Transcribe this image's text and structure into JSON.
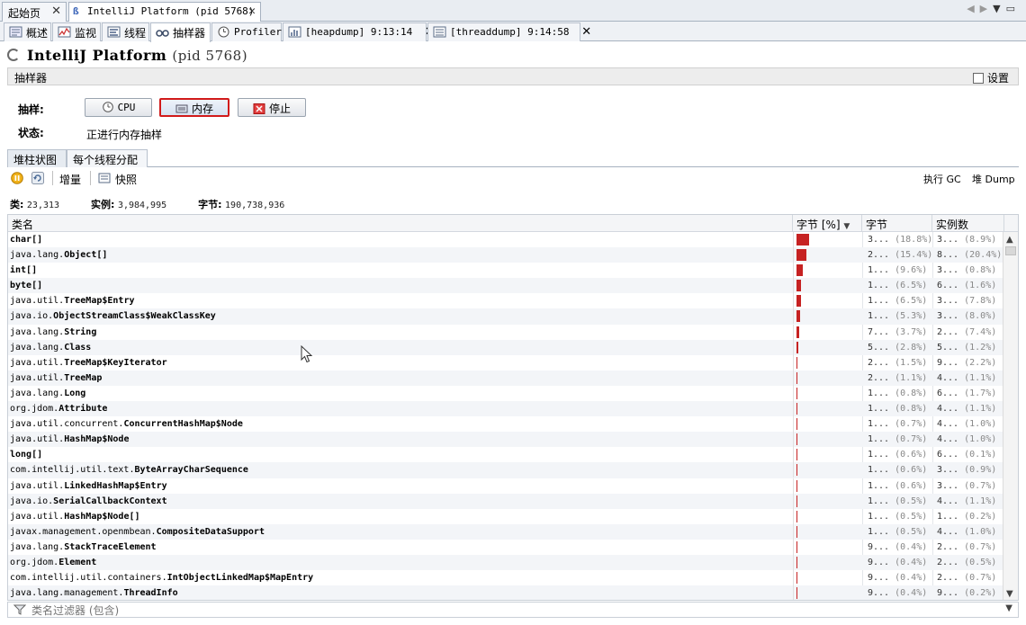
{
  "doc_tabs": [
    {
      "label": "起始页",
      "active": false
    },
    {
      "label": "IntelliJ Platform (pid 5768)",
      "active": true
    }
  ],
  "view_tabs": [
    {
      "label": "概述",
      "icon": "overview-icon"
    },
    {
      "label": "监视",
      "icon": "monitor-icon"
    },
    {
      "label": "线程",
      "icon": "threads-icon"
    },
    {
      "label": "抽样器",
      "icon": "sampler-icon"
    },
    {
      "label": "Profiler",
      "icon": "profiler-icon"
    },
    {
      "label": "[heapdump] 9:13:14",
      "icon": "heapdump-icon"
    },
    {
      "label": "[threaddump] 9:14:58",
      "icon": "threaddump-icon"
    }
  ],
  "header": {
    "app": "IntelliJ Platform",
    "pid": "(pid 5768)"
  },
  "sampler": {
    "section_title": "抽样器",
    "settings_label": "设置",
    "sample_label": "抽样:",
    "status_label": "状态:",
    "status_value": "正进行内存抽样",
    "buttons": {
      "cpu": "CPU",
      "memory": "内存",
      "stop": "停止"
    }
  },
  "sub_tabs": [
    "堆柱状图",
    "每个线程分配"
  ],
  "toolbar": {
    "delta": "增量",
    "snapshot": "快照",
    "gc": "执行 GC",
    "heap_dump": "堆 Dump"
  },
  "stats": {
    "classes_label": "类:",
    "classes": "23,313",
    "instances_label": "实例:",
    "instances": "3,984,995",
    "bytes_label": "字节:",
    "bytes": "190,738,936"
  },
  "table": {
    "columns": [
      "类名",
      "字节 [%]",
      "字节",
      "实例数"
    ],
    "rows": [
      {
        "pkg": "",
        "cls": "char[]",
        "pct": 18.8,
        "bytes": "3...",
        "bytes_pct": "(18.8%)",
        "inst": "3...",
        "inst_pct": "(8.9%)"
      },
      {
        "pkg": "java.lang.",
        "cls": "Object[]",
        "pct": 15.4,
        "bytes": "2...",
        "bytes_pct": "(15.4%)",
        "inst": "8...",
        "inst_pct": "(20.4%)"
      },
      {
        "pkg": "",
        "cls": "int[]",
        "pct": 9.6,
        "bytes": "1...",
        "bytes_pct": "(9.6%)",
        "inst": "3...",
        "inst_pct": "(0.8%)"
      },
      {
        "pkg": "",
        "cls": "byte[]",
        "pct": 6.5,
        "bytes": "1...",
        "bytes_pct": "(6.5%)",
        "inst": "6...",
        "inst_pct": "(1.6%)"
      },
      {
        "pkg": "java.util.",
        "cls": "TreeMap$Entry",
        "pct": 6.5,
        "bytes": "1...",
        "bytes_pct": "(6.5%)",
        "inst": "3...",
        "inst_pct": "(7.8%)"
      },
      {
        "pkg": "java.io.",
        "cls": "ObjectStreamClass$WeakClassKey",
        "pct": 5.3,
        "bytes": "1...",
        "bytes_pct": "(5.3%)",
        "inst": "3...",
        "inst_pct": "(8.0%)"
      },
      {
        "pkg": "java.lang.",
        "cls": "String",
        "pct": 3.7,
        "bytes": "7...",
        "bytes_pct": "(3.7%)",
        "inst": "2...",
        "inst_pct": "(7.4%)"
      },
      {
        "pkg": "java.lang.",
        "cls": "Class",
        "pct": 2.8,
        "bytes": "5...",
        "bytes_pct": "(2.8%)",
        "inst": "5...",
        "inst_pct": "(1.2%)"
      },
      {
        "pkg": "java.util.",
        "cls": "TreeMap$KeyIterator",
        "pct": 1.5,
        "bytes": "2...",
        "bytes_pct": "(1.5%)",
        "inst": "9...",
        "inst_pct": "(2.2%)"
      },
      {
        "pkg": "java.util.",
        "cls": "TreeMap",
        "pct": 1.1,
        "bytes": "2...",
        "bytes_pct": "(1.1%)",
        "inst": "4...",
        "inst_pct": "(1.1%)"
      },
      {
        "pkg": "java.lang.",
        "cls": "Long",
        "pct": 0.8,
        "bytes": "1...",
        "bytes_pct": "(0.8%)",
        "inst": "6...",
        "inst_pct": "(1.7%)"
      },
      {
        "pkg": "org.jdom.",
        "cls": "Attribute",
        "pct": 0.8,
        "bytes": "1...",
        "bytes_pct": "(0.8%)",
        "inst": "4...",
        "inst_pct": "(1.1%)"
      },
      {
        "pkg": "java.util.concurrent.",
        "cls": "ConcurrentHashMap$Node",
        "pct": 0.7,
        "bytes": "1...",
        "bytes_pct": "(0.7%)",
        "inst": "4...",
        "inst_pct": "(1.0%)"
      },
      {
        "pkg": "java.util.",
        "cls": "HashMap$Node",
        "pct": 0.7,
        "bytes": "1...",
        "bytes_pct": "(0.7%)",
        "inst": "4...",
        "inst_pct": "(1.0%)"
      },
      {
        "pkg": "",
        "cls": "long[]",
        "pct": 0.6,
        "bytes": "1...",
        "bytes_pct": "(0.6%)",
        "inst": "6...",
        "inst_pct": "(0.1%)"
      },
      {
        "pkg": "com.intellij.util.text.",
        "cls": "ByteArrayCharSequence",
        "pct": 0.6,
        "bytes": "1...",
        "bytes_pct": "(0.6%)",
        "inst": "3...",
        "inst_pct": "(0.9%)"
      },
      {
        "pkg": "java.util.",
        "cls": "LinkedHashMap$Entry",
        "pct": 0.6,
        "bytes": "1...",
        "bytes_pct": "(0.6%)",
        "inst": "3...",
        "inst_pct": "(0.7%)"
      },
      {
        "pkg": "java.io.",
        "cls": "SerialCallbackContext",
        "pct": 0.5,
        "bytes": "1...",
        "bytes_pct": "(0.5%)",
        "inst": "4...",
        "inst_pct": "(1.1%)"
      },
      {
        "pkg": "java.util.",
        "cls": "HashMap$Node[]",
        "pct": 0.5,
        "bytes": "1...",
        "bytes_pct": "(0.5%)",
        "inst": "1...",
        "inst_pct": "(0.2%)"
      },
      {
        "pkg": "javax.management.openmbean.",
        "cls": "CompositeDataSupport",
        "pct": 0.5,
        "bytes": "1...",
        "bytes_pct": "(0.5%)",
        "inst": "4...",
        "inst_pct": "(1.0%)"
      },
      {
        "pkg": "java.lang.",
        "cls": "StackTraceElement",
        "pct": 0.4,
        "bytes": "9...",
        "bytes_pct": "(0.4%)",
        "inst": "2...",
        "inst_pct": "(0.7%)"
      },
      {
        "pkg": "org.jdom.",
        "cls": "Element",
        "pct": 0.4,
        "bytes": "9...",
        "bytes_pct": "(0.4%)",
        "inst": "2...",
        "inst_pct": "(0.5%)"
      },
      {
        "pkg": "com.intellij.util.containers.",
        "cls": "IntObjectLinkedMap$MapEntry",
        "pct": 0.4,
        "bytes": "9...",
        "bytes_pct": "(0.4%)",
        "inst": "2...",
        "inst_pct": "(0.7%)"
      },
      {
        "pkg": "java.lang.management.",
        "cls": "ThreadInfo",
        "pct": 0.4,
        "bytes": "9...",
        "bytes_pct": "(0.4%)",
        "inst": "9...",
        "inst_pct": "(0.2%)"
      }
    ]
  },
  "filter": {
    "placeholder": "类名过滤器 (包含)"
  },
  "colors": {
    "bar": "#c62222",
    "accent_border": "#d11a1a"
  }
}
